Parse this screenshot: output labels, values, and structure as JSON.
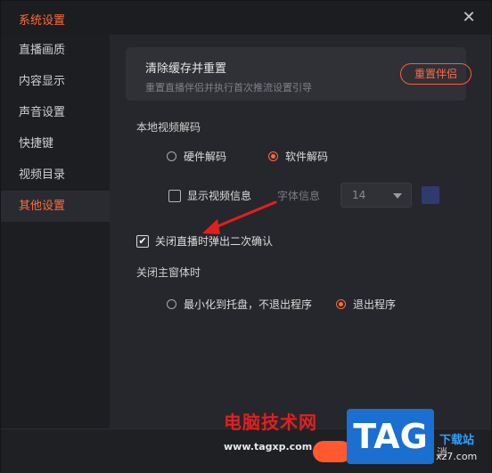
{
  "window": {
    "title": "系统设置",
    "close_glyph": "✕"
  },
  "sidebar": {
    "items": [
      {
        "label": "直播画质"
      },
      {
        "label": "内容显示"
      },
      {
        "label": "声音设置"
      },
      {
        "label": "快捷键"
      },
      {
        "label": "视频目录"
      },
      {
        "label": "其他设置"
      }
    ],
    "active_index": 5
  },
  "cache_card": {
    "title": "清除缓存并重置",
    "subtitle": "重置直播伴侣并执行首次推流设置引导",
    "button": "重置伴侣"
  },
  "decode": {
    "label": "本地视频解码",
    "options": [
      "硬件解码",
      "软件解码"
    ],
    "selected": "软件解码"
  },
  "video_info": {
    "checkbox_label": "显示视频信息",
    "checked": false,
    "font_label": "字体信息",
    "font_size": "14"
  },
  "confirm_close_live": {
    "label": "关闭直播时弹出二次确认",
    "checked": true
  },
  "close_main": {
    "label": "关闭主窗体时",
    "options": [
      "最小化到托盘，不退出程序",
      "退出程序"
    ],
    "selected": "退出程序"
  },
  "watermark": {
    "site_name": "电脑技术网",
    "site_url": "www.tagxp.com",
    "tag": "TAG",
    "right_text": "下载站",
    "right_url": "xz7.com"
  },
  "footer": {
    "partial_text": "消"
  },
  "colors": {
    "accent": "#ff6a3d",
    "annotation_arrow": "#e02020"
  }
}
